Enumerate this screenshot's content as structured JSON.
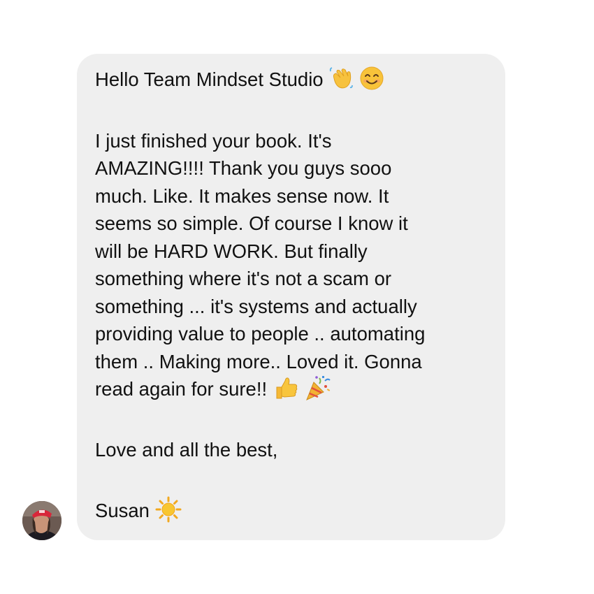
{
  "message": {
    "greeting": "Hello Team Mindset Studio",
    "greeting_emojis": [
      "waving-hand-icon",
      "smiling-face-icon"
    ],
    "body_lines": [
      "I just finished your book. It's",
      "AMAZING!!!! Thank you guys sooo",
      "much. Like. It makes sense now. It",
      "seems so simple. Of course I know it",
      "will be HARD WORK. But finally",
      "something where it's not a scam or",
      "something ... it's systems and actually",
      "providing value to people .. automating",
      "them .. Making more.. Loved it. Gonna",
      "read again for sure!!"
    ],
    "body_emojis": [
      "thumbs-up-icon",
      "party-popper-icon"
    ],
    "closing": "Love and all the best,",
    "signature": "Susan",
    "signature_emoji": "sun-icon"
  },
  "colors": {
    "bubble": "#efefef",
    "text": "#111111",
    "background": "#ffffff"
  }
}
